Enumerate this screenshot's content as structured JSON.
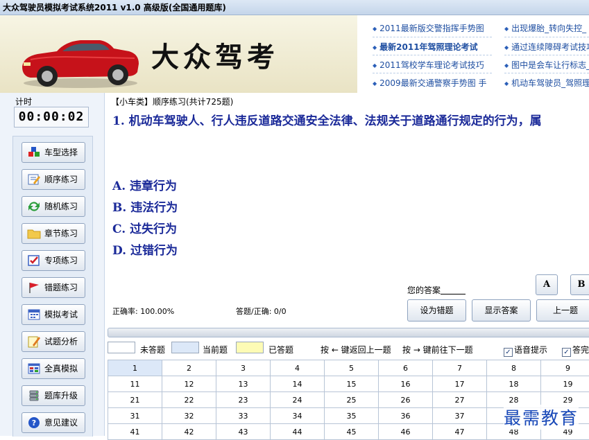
{
  "window": {
    "title": "大众驾驶员模拟考试系统2011 v1.0 高级版(全国通用题库)"
  },
  "header": {
    "brand": "大众驾考",
    "news_left": [
      "2011最新版交警指挥手势图",
      "最新2011年驾照理论考试",
      "2011驾校学车理论考试技巧",
      "2009最新交通警察手势图 手"
    ],
    "news_right": [
      "出现爆胎_转向失控_",
      "通过连续障碍考试技巧",
      "图中是会车让行标志_",
      "机动车驾驶员_驾照理"
    ]
  },
  "sidebar": {
    "timer_label": "计时",
    "timer_value": "00:00:02",
    "items": [
      {
        "label": "车型选择",
        "icon": "cubes-icon"
      },
      {
        "label": "顺序练习",
        "icon": "pencil-note-icon"
      },
      {
        "label": "随机练习",
        "icon": "refresh-arrows-icon"
      },
      {
        "label": "章节练习",
        "icon": "folder-icon"
      },
      {
        "label": "专项练习",
        "icon": "checkbox-icon"
      },
      {
        "label": "错题练习",
        "icon": "red-flag-icon"
      },
      {
        "label": "模拟考试",
        "icon": "calendar-icon"
      },
      {
        "label": "试题分析",
        "icon": "note-pencil-icon"
      },
      {
        "label": "全真模拟",
        "icon": "window-grid-icon"
      },
      {
        "label": "题库升级",
        "icon": "database-icon"
      },
      {
        "label": "意见建议",
        "icon": "question-circle-icon"
      }
    ]
  },
  "question": {
    "header": "【小车类】顺序练习(共计725题)",
    "text": "1. 机动车驾驶人、行人违反道路交通安全法律、法规关于道路通行规定的行为，属",
    "options": [
      "A. 违章行为",
      "B. 违法行为",
      "C. 过失行为",
      "D. 过错行为"
    ]
  },
  "answer": {
    "label": "您的答案",
    "buttons": [
      "A",
      "B"
    ],
    "accuracy": "正确率: 100.00%",
    "answered": "答题/正确: 0/0",
    "actions": [
      "设为错题",
      "显示答案",
      "上一题"
    ]
  },
  "legend": {
    "unanswered": "未答题",
    "current": "当前题",
    "answered": "已答题",
    "hint_back": "按 ← 键返回上一题",
    "hint_forward": "按 → 键前往下一题",
    "voice": "语音提示",
    "answer_check": "答完",
    "colors": {
      "unanswered": "#ffffff",
      "current": "#dce8f8",
      "answered": "#fdfbb5"
    }
  },
  "grid": {
    "rows": [
      [
        "1",
        "2",
        "3",
        "4",
        "5",
        "6",
        "7",
        "8",
        "9"
      ],
      [
        "11",
        "12",
        "13",
        "14",
        "15",
        "16",
        "17",
        "18",
        "19"
      ],
      [
        "21",
        "22",
        "23",
        "24",
        "25",
        "26",
        "27",
        "28",
        "29"
      ],
      [
        "31",
        "32",
        "33",
        "34",
        "35",
        "36",
        "37",
        "38",
        "39"
      ],
      [
        "41",
        "42",
        "43",
        "44",
        "45",
        "46",
        "47",
        "48",
        "49"
      ]
    ]
  },
  "watermark": "最需教育"
}
